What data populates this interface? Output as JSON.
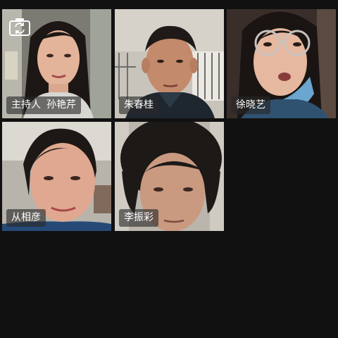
{
  "participants": [
    {
      "name": "孙艳芹",
      "role": "主持人"
    },
    {
      "name": "朱春桂"
    },
    {
      "name": "徐晓艺"
    },
    {
      "name": "从相彦"
    },
    {
      "name": "李振彩"
    }
  ],
  "icons": {
    "camera_switch": "camera-switch-icon"
  },
  "colors": {
    "background": "#111111",
    "name_tag_bg": "rgba(40,40,40,0.62)",
    "name_tag_text": "#ffffff"
  }
}
